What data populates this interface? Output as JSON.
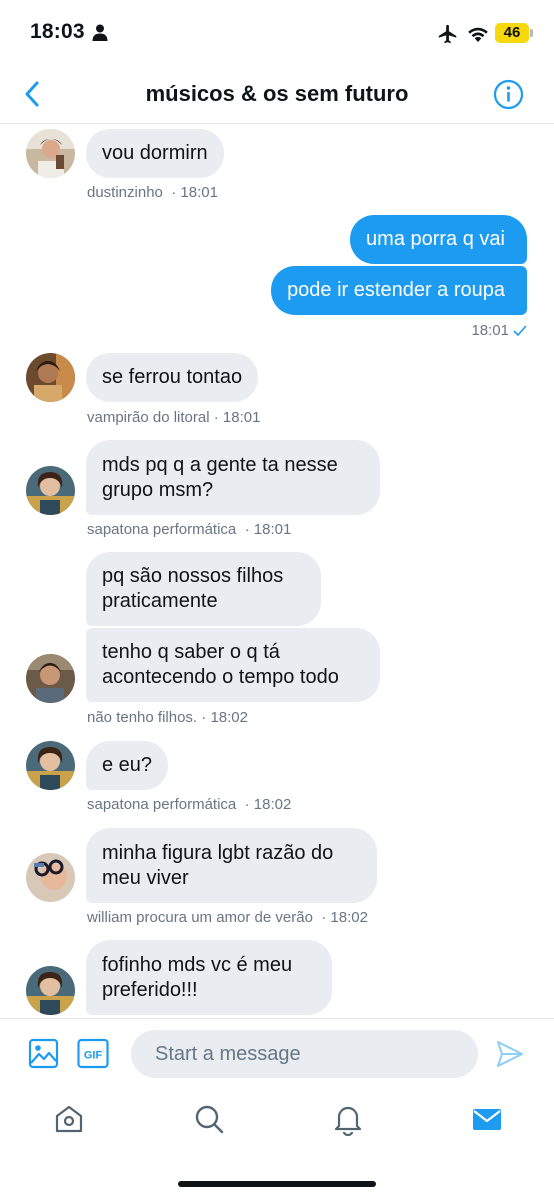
{
  "status_bar": {
    "time": "18:03",
    "battery": "46"
  },
  "header": {
    "title": "músicos & os sem futuro"
  },
  "messages": [
    {
      "side": "in",
      "text": "vou dormirn",
      "sender": "dustinzinho",
      "time": "18:01"
    },
    {
      "side": "out",
      "text": "uma porra q vai"
    },
    {
      "side": "out",
      "text": "pode ir estender a roupa",
      "time": "18:01"
    },
    {
      "side": "in",
      "text": "se ferrou tontao",
      "sender": "vampirão do litoral",
      "time": "18:01"
    },
    {
      "side": "in",
      "text": "mds pq q a gente ta nesse grupo msm?",
      "sender": "sapatona performática",
      "time": "18:01"
    },
    {
      "side": "in",
      "text": "pq são nossos filhos praticamente"
    },
    {
      "side": "in",
      "text": "tenho q saber o q tá acontecendo o tempo todo",
      "sender": "não tenho filhos.",
      "time": "18:02"
    },
    {
      "side": "in",
      "text": "e eu?",
      "sender": "sapatona performática",
      "time": "18:02"
    },
    {
      "side": "in",
      "text": "minha figura lgbt razão do meu viver",
      "sender": "william procura um amor de verão",
      "time": "18:02"
    },
    {
      "side": "in",
      "text": "fofinho mds vc é meu preferido!!!"
    }
  ],
  "composer": {
    "placeholder": "Start a message",
    "gif_label": "GIF"
  },
  "colors": {
    "accent": "#1d9bf0",
    "incoming_bubble": "#e9ecf1",
    "meta_text": "#687684"
  }
}
